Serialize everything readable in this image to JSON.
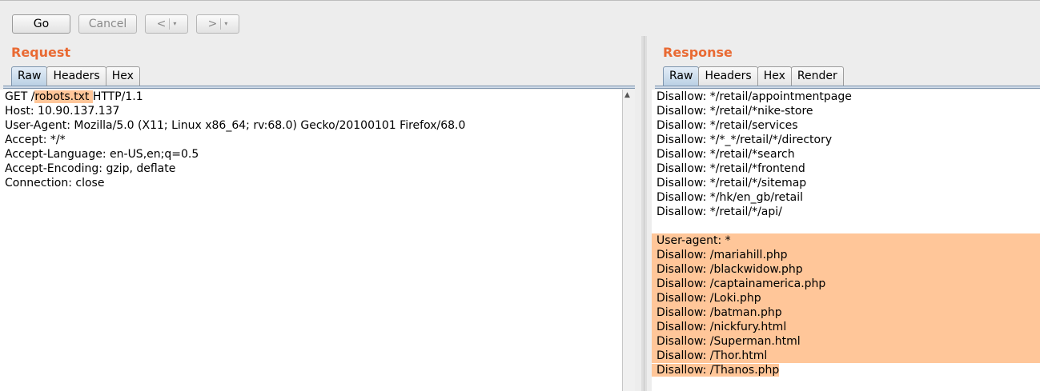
{
  "toolbar": {
    "go_label": "Go",
    "cancel_label": "Cancel",
    "back_label": "<",
    "forward_label": ">",
    "dropdown_glyph": "▾"
  },
  "request": {
    "title": "Request",
    "tabs": [
      "Raw",
      "Headers",
      "Hex"
    ],
    "active_tab": "Raw",
    "line1": {
      "pre": "GET /",
      "highlight": "robots.txt ",
      "post": "HTTP/1.1"
    },
    "lines": [
      "Host: 10.90.137.137",
      "User-Agent: Mozilla/5.0 (X11; Linux x86_64; rv:68.0) Gecko/20100101 Firefox/68.0",
      "Accept: */*",
      "Accept-Language: en-US,en;q=0.5",
      "Accept-Encoding: gzip, deflate",
      "Connection: close"
    ]
  },
  "response": {
    "title": "Response",
    "tabs": [
      "Raw",
      "Headers",
      "Hex",
      "Render"
    ],
    "active_tab": "Raw",
    "lines": [
      "Disallow: */retail/appointmentpage",
      "Disallow: */retail/*nike-store",
      "Disallow: */retail/services",
      "Disallow: */*_*/retail/*/directory",
      "Disallow: */retail/*search",
      "Disallow: */retail/*frontend",
      "Disallow: */retail/*/sitemap",
      "Disallow: */hk/en_gb/retail",
      "Disallow: */retail/*/api/",
      ""
    ],
    "highlighted_lines": [
      "User-agent: *",
      "Disallow: /mariahill.php",
      "Disallow: /blackwidow.php",
      "Disallow: /captainamerica.php",
      "Disallow: /Loki.php",
      "Disallow: /batman.php",
      "Disallow: /nickfury.html",
      "Disallow: /Superman.html",
      "Disallow: /Thor.html"
    ],
    "last_highlighted_line": "Disallow: /Thanos.php"
  },
  "colors": {
    "accent": "#e96a33",
    "highlight": "#ffc699",
    "tab_active": "#b9cfe3"
  },
  "icons": {
    "scroll_up": "▲"
  }
}
